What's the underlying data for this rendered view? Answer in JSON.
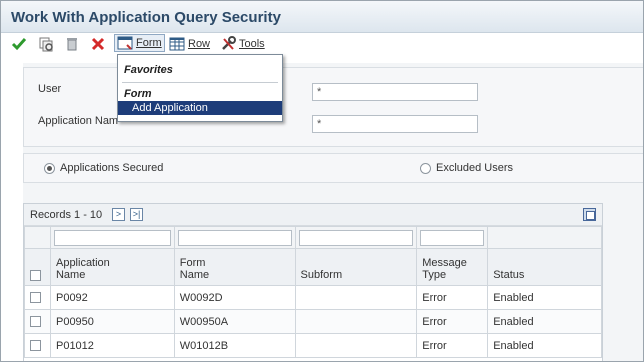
{
  "window": {
    "title": "Work With Application Query Security"
  },
  "toolbar": {
    "form_label": "Form",
    "row_label": "Row",
    "tools_label": "Tools"
  },
  "criteria": {
    "user_label": "User",
    "user_value": "*",
    "app_name_label": "Application Nam",
    "app_name_value": "*"
  },
  "radios": {
    "secured_label": "Applications Secured",
    "secured_selected": true,
    "excluded_label": "Excluded Users",
    "excluded_selected": false
  },
  "grid": {
    "records": "Records 1 - 10",
    "next_glyph": ">",
    "last_glyph": ">|",
    "columns": {
      "app_name": "Application\nName",
      "form_name": "Form\nName",
      "subform": "Subform",
      "message_type": "Message\nType",
      "status": "Status"
    },
    "rows": [
      {
        "app": "P0092",
        "form": "W0092D",
        "subform": "",
        "msg": "Error",
        "status": "Enabled"
      },
      {
        "app": "P00950",
        "form": "W00950A",
        "subform": "",
        "msg": "Error",
        "status": "Enabled"
      },
      {
        "app": "P01012",
        "form": "W01012B",
        "subform": "",
        "msg": "Error",
        "status": "Enabled"
      }
    ]
  },
  "menu": {
    "favorites_label": "Favorites",
    "form_section_label": "Form",
    "add_application_label": "Add Application"
  },
  "icons": {
    "ok": "check-icon",
    "copy": "copy-icon",
    "delete": "trash-icon",
    "close": "close-icon",
    "form": "form-icon",
    "row": "grid-icon",
    "tools": "tools-icon"
  },
  "colors": {
    "title_text": "#2c4a68",
    "menu_highlight": "#1e3d7a",
    "ok_green": "#2e9a2e",
    "close_red": "#d42a2a"
  }
}
